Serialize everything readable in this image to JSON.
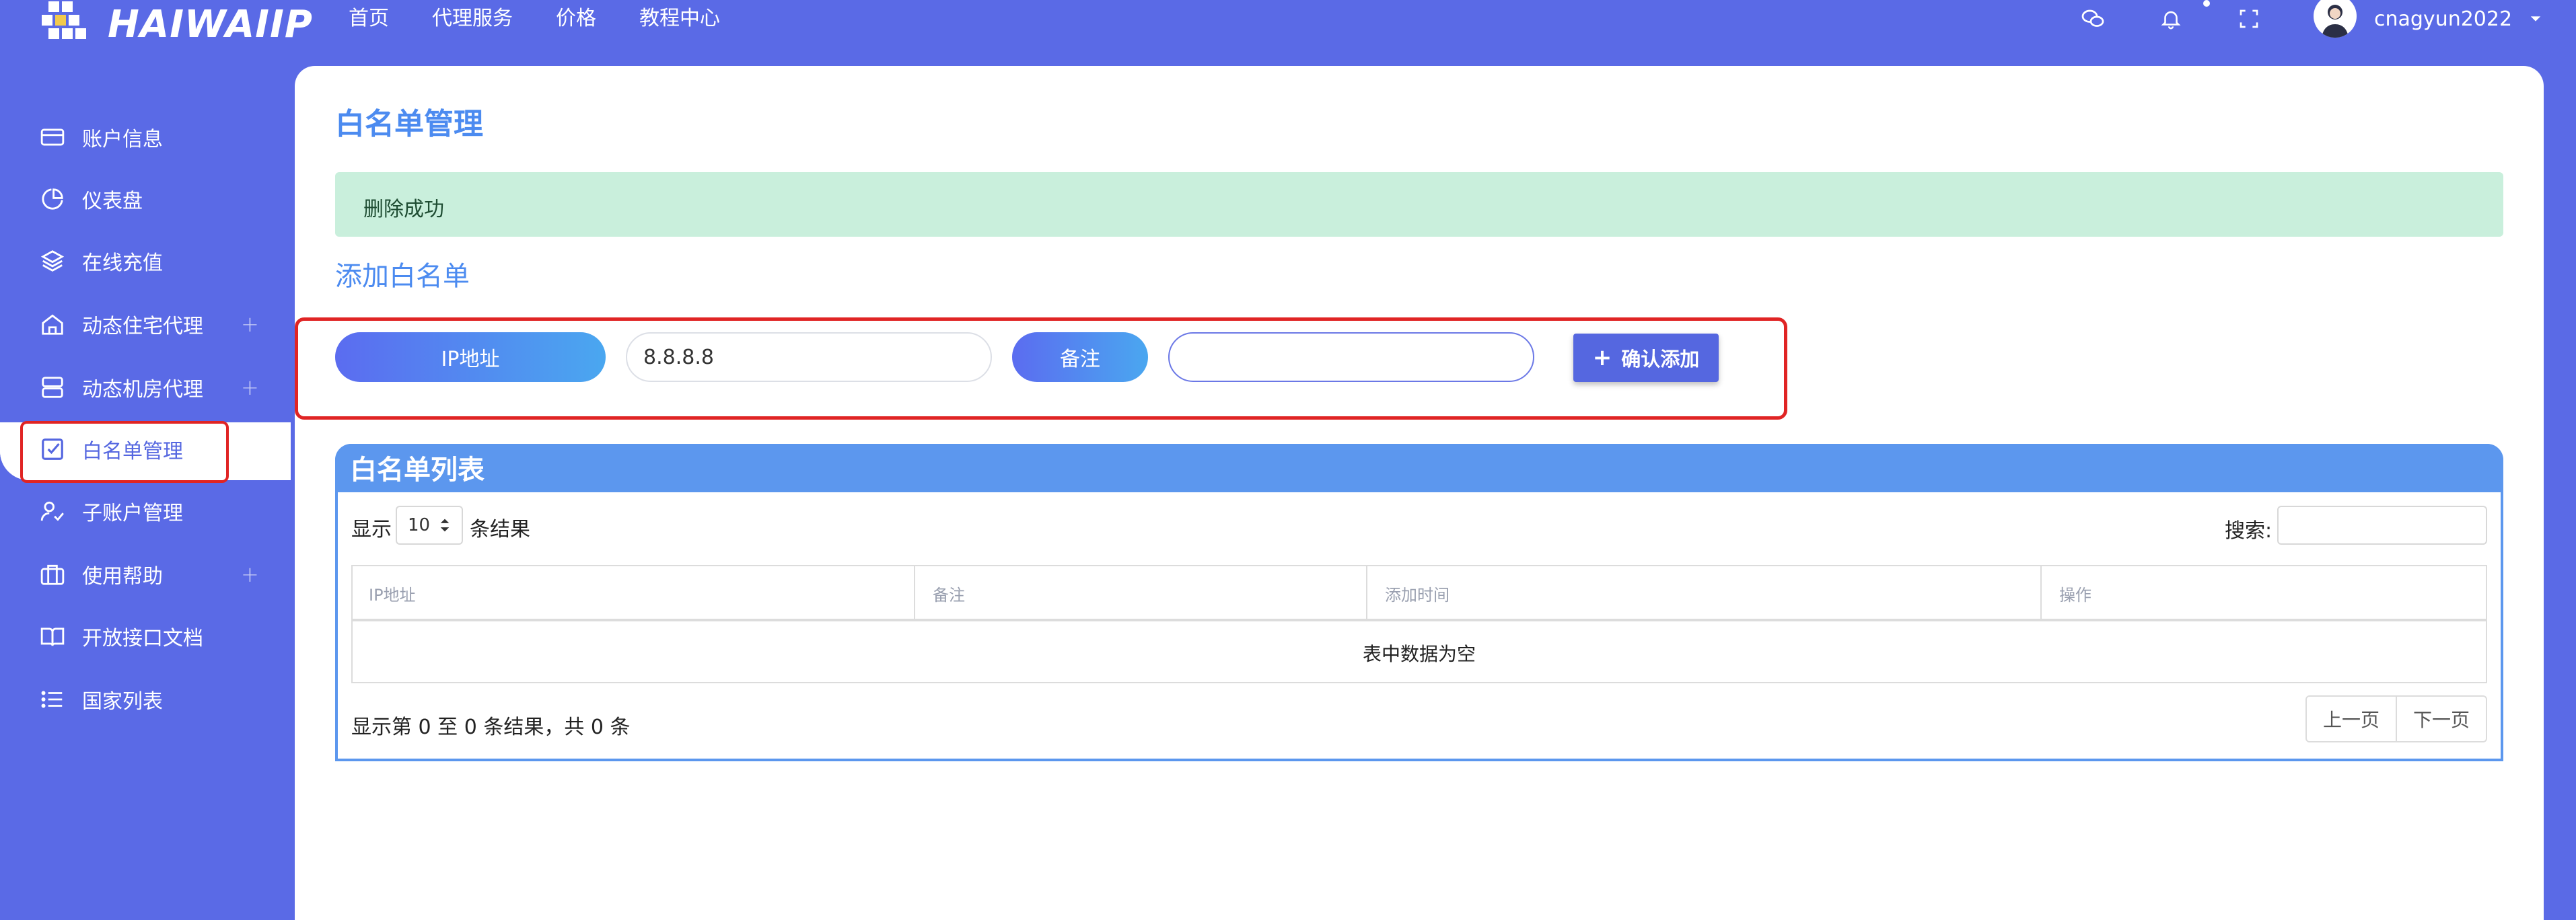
{
  "brand": {
    "name": "HAIWAIIP"
  },
  "topnav": [
    "首页",
    "代理服务",
    "价格",
    "教程中心"
  ],
  "header": {
    "icons": [
      "wechat-icon",
      "bell-icon",
      "fullscreen-icon"
    ],
    "username": "cnagyun2022"
  },
  "sidebar": {
    "items": [
      {
        "label": "账户信息",
        "icon": "card-icon"
      },
      {
        "label": "仪表盘",
        "icon": "pie-chart-icon"
      },
      {
        "label": "在线充值",
        "icon": "layers-icon"
      },
      {
        "label": "动态住宅代理",
        "icon": "home-icon",
        "expand": "+"
      },
      {
        "label": "动态机房代理",
        "icon": "server-icon",
        "expand": "+"
      },
      {
        "label": "白名单管理",
        "icon": "checkbox-icon",
        "active": true
      },
      {
        "label": "子账户管理",
        "icon": "user-check-icon"
      },
      {
        "label": "使用帮助",
        "icon": "briefcase-icon",
        "expand": "+"
      },
      {
        "label": "开放接口文档",
        "icon": "book-icon"
      },
      {
        "label": "国家列表",
        "icon": "list-icon"
      }
    ]
  },
  "main": {
    "title": "白名单管理",
    "alert": "删除成功",
    "section_title": "添加白名单",
    "form": {
      "ip_label": "IP地址",
      "ip_value": "8.8.8.8",
      "note_label": "备注",
      "note_value": "",
      "submit": "确认添加"
    },
    "list": {
      "title": "白名单列表",
      "show_prefix": "显示",
      "page_length": "10",
      "show_suffix": "条结果",
      "search_label": "搜索:",
      "columns": [
        "IP地址",
        "备注",
        "添加时间",
        "操作"
      ],
      "empty": "表中数据为空",
      "info": "显示第 0 至 0 条结果，共 0 条",
      "prev": "上一页",
      "next": "下一页"
    }
  },
  "colors": {
    "background": "#5a6ae6",
    "accent": "#4c8bf0",
    "alert_bg": "#c9efdc",
    "highlight": "#e02424"
  }
}
